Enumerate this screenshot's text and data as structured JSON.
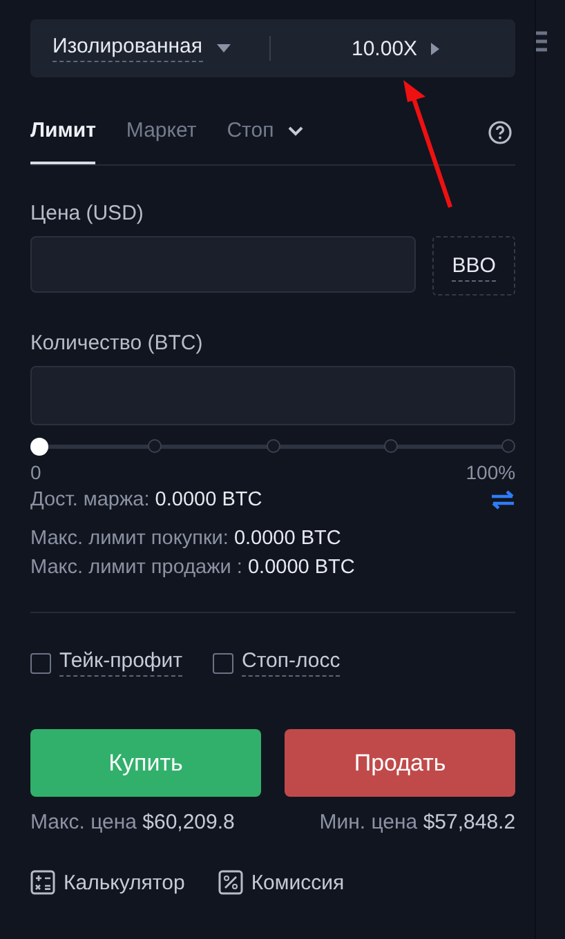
{
  "mode_bar": {
    "margin_mode": "Изолированная",
    "leverage": "10.00X"
  },
  "tabs": [
    {
      "label": "Лимит",
      "selected": true,
      "kind": "plain"
    },
    {
      "label": "Маркет",
      "selected": false,
      "kind": "plain"
    },
    {
      "label": "Стоп",
      "selected": false,
      "kind": "dropdown"
    }
  ],
  "price": {
    "label": "Цена (USD)",
    "bbo": "BBO"
  },
  "quantity": {
    "label": "Количество (BTC)",
    "level": 0,
    "min_label": "0",
    "max_label": "100%"
  },
  "available": {
    "label": "Дост. маржа:",
    "value": "0.0000 BTC"
  },
  "limits": [
    {
      "label": "Макс. лимит покупки:",
      "value": "0.0000 BTC"
    },
    {
      "label": "Макс. лимит продажи :",
      "value": "0.0000 BTC"
    }
  ],
  "options": [
    {
      "label": "Тейк-профит",
      "checked": false
    },
    {
      "label": "Стоп-лосс",
      "checked": false
    }
  ],
  "actions": [
    {
      "label": "Купить",
      "kind": "buy",
      "price_label": "Макс. цена",
      "price": "$60,209.8"
    },
    {
      "label": "Продать",
      "kind": "sell",
      "price_label": "Мин. цена",
      "price": "$57,848.2"
    }
  ],
  "footer": [
    {
      "label": "Калькулятор",
      "kind": "calculator"
    },
    {
      "label": "Комиссия",
      "kind": "fee"
    }
  ]
}
